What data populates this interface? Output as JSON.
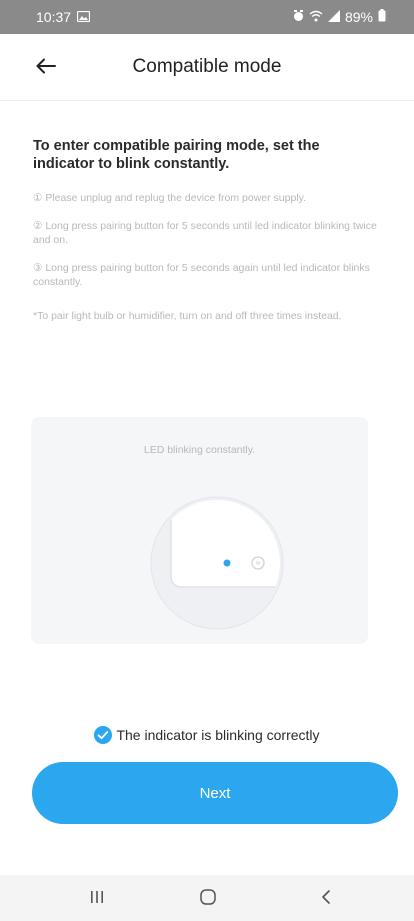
{
  "status_bar": {
    "time": "10:37",
    "battery": "89%",
    "icons": [
      "gallery-icon",
      "alarm-icon",
      "wifi-icon",
      "signal-icon",
      "battery-icon"
    ]
  },
  "header": {
    "title": "Compatible mode",
    "back_icon": "arrow-left-icon"
  },
  "instructions": {
    "heading": "To enter compatible pairing mode, set the indicator to blink constantly.",
    "steps": [
      "① Please unplug and replug the device from power supply.",
      "② Long press pairing button for 5 seconds until led indicator blinking twice and on.",
      "③ Long press pairing button for 5 seconds again until led indicator blinks constantly."
    ],
    "note": "*To pair light bulb or humidifier, turn on and off three times instead."
  },
  "illustration": {
    "caption": "LED blinking constantly."
  },
  "confirm": {
    "label": "The indicator is blinking correctly",
    "checked": true
  },
  "next_button": {
    "label": "Next"
  },
  "colors": {
    "accent": "#2aa7ee",
    "status_bar": "#8a8a8a",
    "card_bg": "#f5f6f8",
    "muted_text": "#b8b8b8"
  },
  "nav_bar": {
    "icons": [
      "recents-icon",
      "home-icon",
      "back-nav-icon"
    ]
  }
}
